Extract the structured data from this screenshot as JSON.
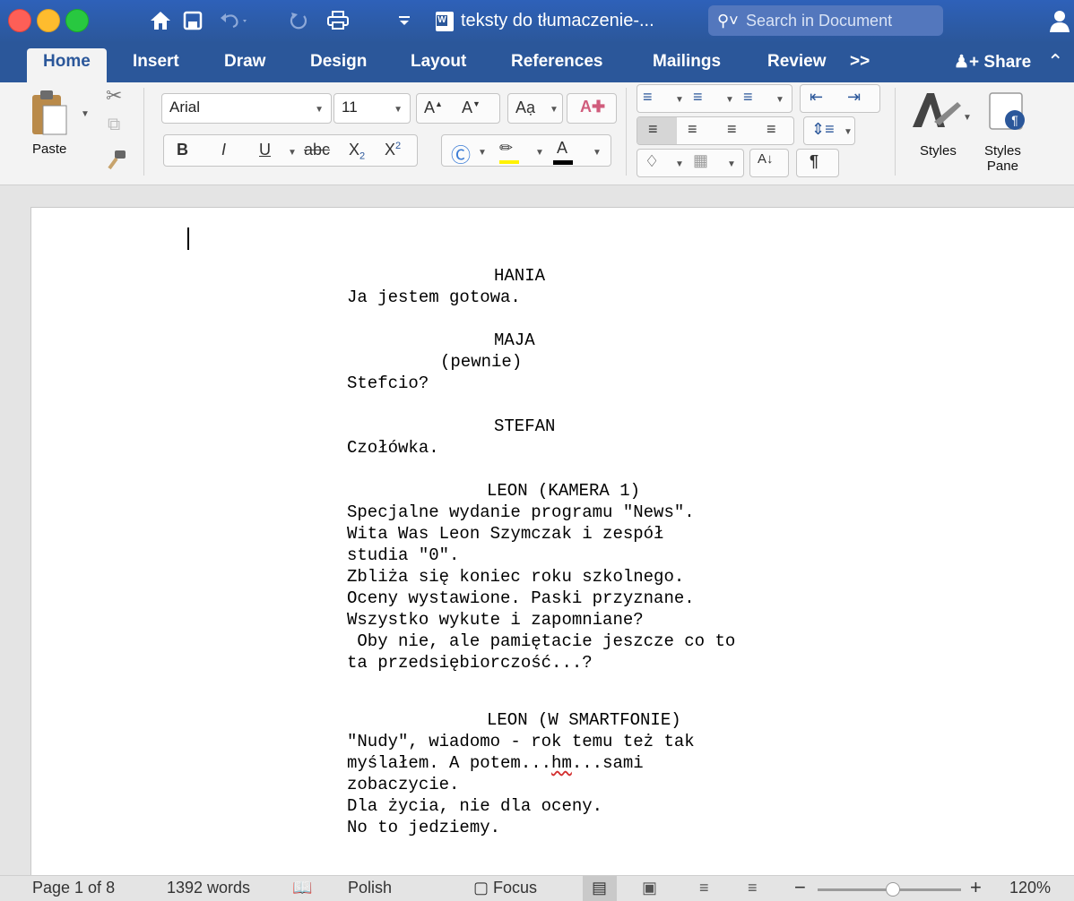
{
  "titlebar": {
    "document_title": "teksty do tłumaczenie-...",
    "search_placeholder": "Search in Document"
  },
  "tabs": [
    {
      "label": "Home",
      "active": true
    },
    {
      "label": "Insert"
    },
    {
      "label": "Draw"
    },
    {
      "label": "Design"
    },
    {
      "label": "Layout"
    },
    {
      "label": "References"
    },
    {
      "label": "Mailings"
    },
    {
      "label": "Review"
    },
    {
      "label": ">>"
    }
  ],
  "share_label": "Share",
  "ribbon": {
    "paste_label": "Paste",
    "font_name": "Arial",
    "font_size": "11",
    "bold": "B",
    "italic": "I",
    "underline": "U",
    "strike": "abc",
    "styles_label": "Styles",
    "styles_pane_label_1": "Styles",
    "styles_pane_label_2": "Pane"
  },
  "document": {
    "lines": [
      {
        "text": "HANIA"
      },
      {
        "text": "Ja jestem gotowa."
      },
      {
        "text": "MAJA"
      },
      {
        "text": "(pewnie)"
      },
      {
        "text": "Stefcio?"
      },
      {
        "text": "STEFAN"
      },
      {
        "text": "Czołówka."
      },
      {
        "text": "LEON (KAMERA 1)"
      },
      {
        "text": "Specjalne wydanie programu \"News\"."
      },
      {
        "text": "Wita Was Leon Szymczak i zespół"
      },
      {
        "text": "studia \"0\"."
      },
      {
        "text": "Zbliża się koniec roku szkolnego."
      },
      {
        "text": "Oceny wystawione. Paski przyznane."
      },
      {
        "text": "Wszystko wykute i zapomniane?"
      },
      {
        "text": " Oby nie, ale pamiętacie jeszcze co to"
      },
      {
        "text": "ta przedsiębiorczość...?"
      },
      {
        "text": "LEON (W SMARTFONIE)"
      },
      {
        "text": "\"Nudy\", wiadomo - rok temu też tak"
      },
      {
        "text_a": "myślałem. A potem...",
        "text_b": "hm",
        "text_c": "...sami"
      },
      {
        "text": "zobaczycie."
      },
      {
        "text": "Dla życia, nie dla oceny."
      },
      {
        "text": "No to jedziemy."
      }
    ]
  },
  "statusbar": {
    "page": "Page 1 of 8",
    "words": "1392 words",
    "language": "Polish",
    "focus": "Focus",
    "zoom_percent": "120%",
    "zoom_level": 1.2
  }
}
